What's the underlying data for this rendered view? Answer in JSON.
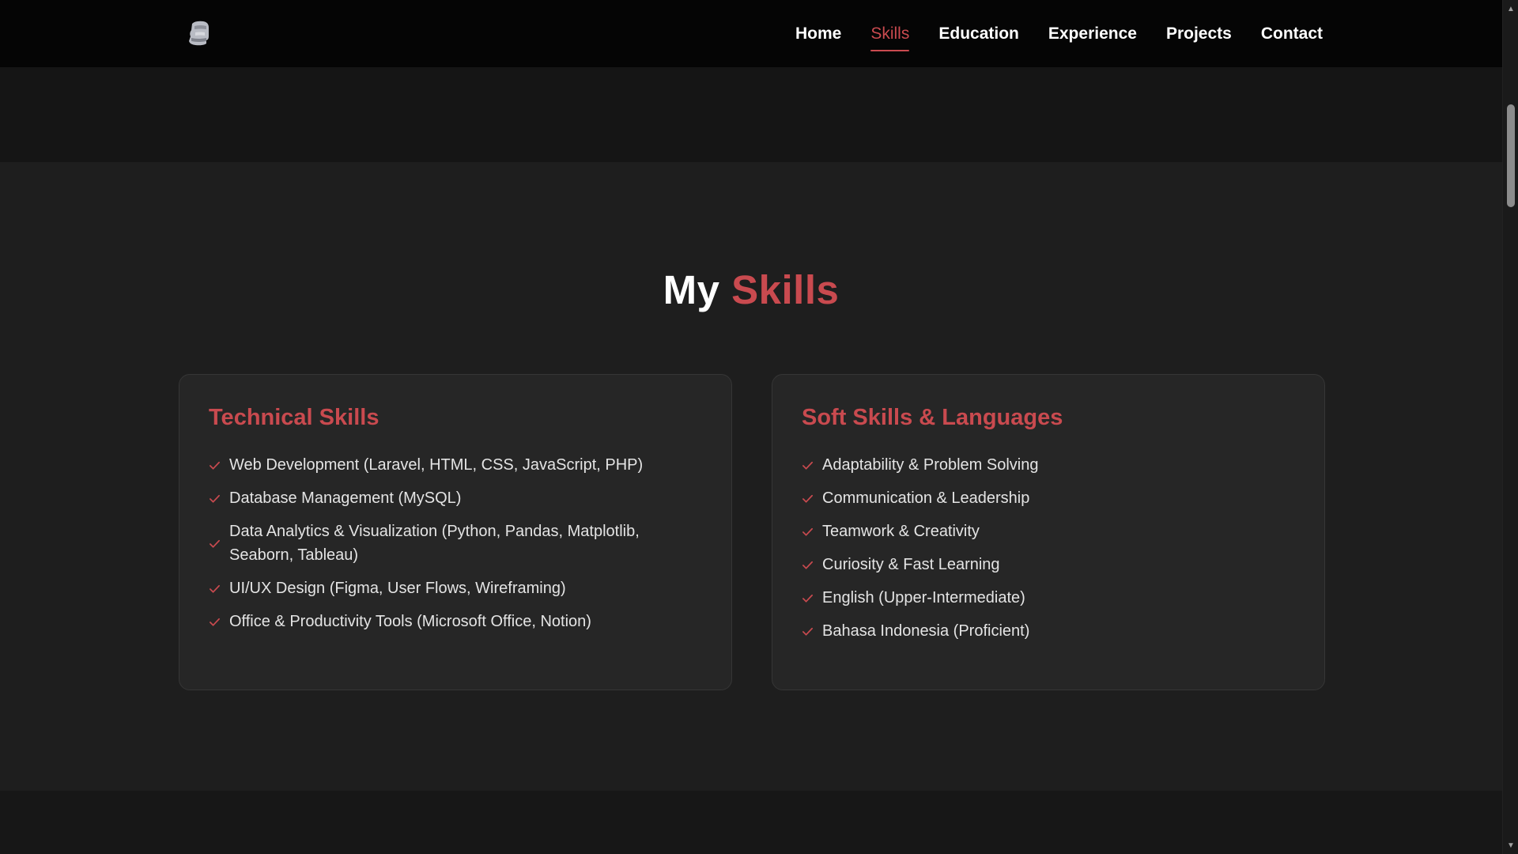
{
  "nav": {
    "logo_icon": "bust-statue-icon",
    "links": [
      {
        "label": "Home",
        "active": false
      },
      {
        "label": "Skills",
        "active": true
      },
      {
        "label": "Education",
        "active": false
      },
      {
        "label": "Experience",
        "active": false
      },
      {
        "label": "Projects",
        "active": false
      },
      {
        "label": "Contact",
        "active": false
      }
    ]
  },
  "skills": {
    "title_prefix": "My",
    "title_accent": "Skills",
    "technical": {
      "title": "Technical Skills",
      "items": [
        "Web Development (Laravel, HTML, CSS, JavaScript, PHP)",
        "Database Management (MySQL)",
        "Data Analytics & Visualization (Python, Pandas, Matplotlib, Seaborn, Tableau)",
        "UI/UX Design (Figma, User Flows, Wireframing)",
        "Office & Productivity Tools (Microsoft Office, Notion)"
      ]
    },
    "soft": {
      "title": "Soft Skills & Languages",
      "items": [
        "Adaptability & Problem Solving",
        "Communication & Leadership",
        "Teamwork & Creativity",
        "Curiosity & Fast Learning",
        "English (Upper-Intermediate)",
        "Bahasa Indonesia (Proficient)"
      ]
    }
  },
  "colors": {
    "accent": "#c94a4f",
    "background": "#1e1e1e",
    "navbar": "#050505",
    "card": "#262626"
  }
}
